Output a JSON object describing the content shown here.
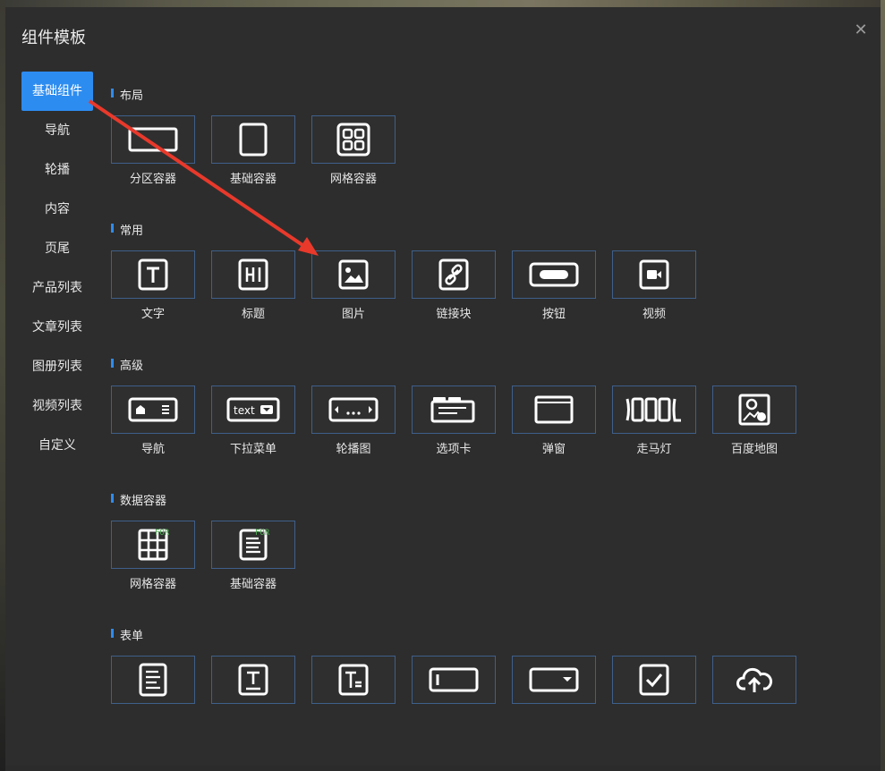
{
  "dialog": {
    "title": "组件模板",
    "close_icon": "close-icon"
  },
  "sidebar": {
    "items": [
      {
        "label": "基础组件",
        "active": true
      },
      {
        "label": "导航"
      },
      {
        "label": "轮播"
      },
      {
        "label": "内容"
      },
      {
        "label": "页尾"
      },
      {
        "label": "产品列表"
      },
      {
        "label": "文章列表"
      },
      {
        "label": "图册列表"
      },
      {
        "label": "视频列表"
      },
      {
        "label": "自定义"
      }
    ]
  },
  "sections": [
    {
      "title": "布局",
      "items": [
        {
          "label": "分区容器",
          "icon": "section-container-icon"
        },
        {
          "label": "基础容器",
          "icon": "basic-container-icon"
        },
        {
          "label": "网格容器",
          "icon": "grid-container-icon"
        }
      ]
    },
    {
      "title": "常用",
      "items": [
        {
          "label": "文字",
          "icon": "text-icon"
        },
        {
          "label": "标题",
          "icon": "heading-icon"
        },
        {
          "label": "图片",
          "icon": "image-icon"
        },
        {
          "label": "链接块",
          "icon": "link-icon"
        },
        {
          "label": "按钮",
          "icon": "button-icon"
        },
        {
          "label": "视频",
          "icon": "video-icon"
        }
      ]
    },
    {
      "title": "高级",
      "items": [
        {
          "label": "导航",
          "icon": "nav-icon"
        },
        {
          "label": "下拉菜单",
          "icon": "dropdown-icon",
          "icon_text": "text"
        },
        {
          "label": "轮播图",
          "icon": "carousel-icon"
        },
        {
          "label": "选项卡",
          "icon": "tabs-icon"
        },
        {
          "label": "弹窗",
          "icon": "modal-icon"
        },
        {
          "label": "走马灯",
          "icon": "marquee-icon"
        },
        {
          "label": "百度地图",
          "icon": "baidu-map-icon"
        }
      ]
    },
    {
      "title": "数据容器",
      "items": [
        {
          "label": "网格容器",
          "icon": "data-grid-icon",
          "tag": "FOR"
        },
        {
          "label": "基础容器",
          "icon": "data-basic-icon",
          "tag": "FOR"
        }
      ]
    },
    {
      "title": "表单",
      "items": [
        {
          "label": "",
          "icon": "form-icon"
        },
        {
          "label": "",
          "icon": "single-line-text-icon"
        },
        {
          "label": "",
          "icon": "multi-line-text-icon"
        },
        {
          "label": "",
          "icon": "input-field-icon"
        },
        {
          "label": "",
          "icon": "select-icon"
        },
        {
          "label": "",
          "icon": "checkbox-icon"
        },
        {
          "label": "",
          "icon": "upload-icon"
        }
      ]
    }
  ],
  "colors": {
    "accent": "#2d8cf0",
    "arrow": "#e8392b",
    "tag": "#4caf50",
    "card_border": "#3f5f8a"
  }
}
